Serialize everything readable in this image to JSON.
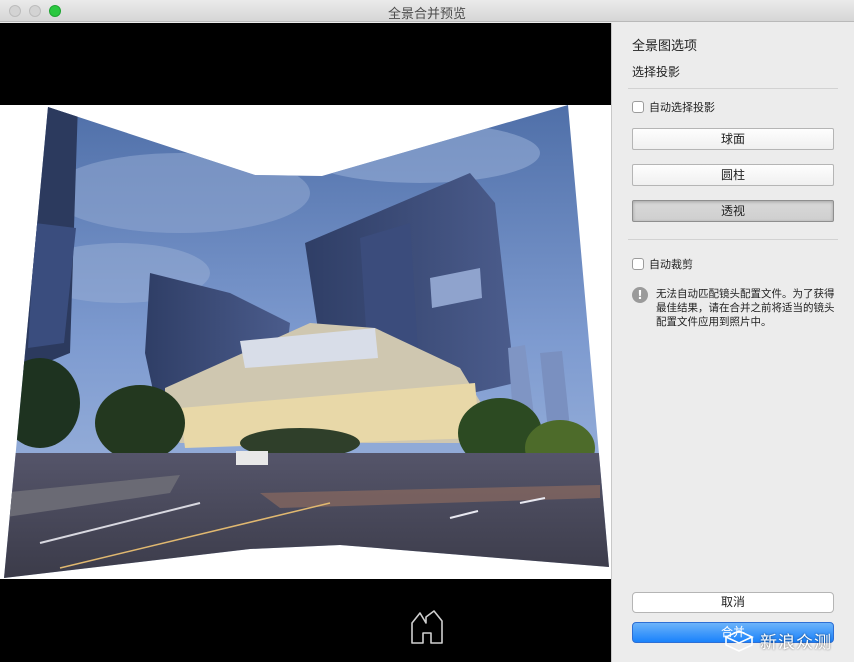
{
  "window": {
    "title": "全景合并预览"
  },
  "panel": {
    "title": "全景图选项",
    "projection_heading": "选择投影",
    "auto_projection_label": "自动选择投影",
    "auto_projection_checked": false,
    "projection_buttons": [
      {
        "label": "球面",
        "active": false
      },
      {
        "label": "圆柱",
        "active": false
      },
      {
        "label": "透视",
        "active": true
      }
    ],
    "auto_crop_label": "自动裁剪",
    "auto_crop_checked": false,
    "warning_text": "无法自动匹配镜头配置文件。为了获得最佳结果，请在合并之前将适当的镜头配置文件应用到照片中。",
    "cancel_label": "取消",
    "merge_label": "合并"
  },
  "preview": {
    "home_icon": "home-icon"
  },
  "watermark": {
    "text": "新浪众测"
  },
  "colors": {
    "accent": "#1a82fb",
    "zoom_button": "#2bc840",
    "sky": "#6b8fc8",
    "road": "#4a4a58"
  }
}
